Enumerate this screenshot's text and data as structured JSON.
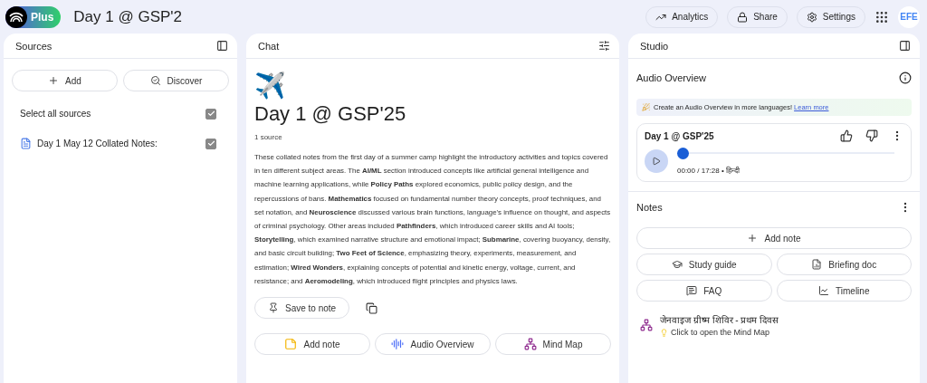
{
  "header": {
    "badge": "Plus",
    "title": "Day 1 @ GSP'2",
    "actions": [
      {
        "kind": "analytics",
        "label": "Analytics"
      },
      {
        "kind": "share",
        "label": "Share"
      },
      {
        "kind": "settings",
        "label": "Settings"
      }
    ],
    "avatar": "EFE"
  },
  "sources": {
    "title": "Sources",
    "buttons": [
      {
        "kind": "add",
        "label": "Add"
      },
      {
        "kind": "discover",
        "label": "Discover"
      }
    ],
    "select_all": {
      "label": "Select all sources",
      "checked": true
    },
    "items": [
      {
        "name": "Day 1 May 12 Collated Notes:",
        "checked": true
      }
    ]
  },
  "chat": {
    "title": "Chat",
    "emoji": "✈️",
    "heading": "Day 1 @ GSP'25",
    "source_count": "1 source",
    "summary": "These collated notes from the first day of a summer camp highlight the introductory activities and topics covered in ten different subject areas. The **AI/ML** section introduced concepts like artificial general intelligence and machine learning applications, while **Policy Paths** explored economics, public policy design, and the repercussions of bans. **Mathematics** focused on fundamental number theory concepts, proof techniques, and set notation, and **Neuroscience** discussed various brain functions, language's influence on thought, and aspects of criminal psychology. Other areas included **Pathfinders**, which introduced career skills and AI tools; **Storytelling**, which examined narrative structure and emotional impact; **Submarine**, covering buoyancy, density, and basic circuit building; **Two Feet of Science**, emphasizing theory, experiments, measurement, and estimation; **Wired Wonders**, explaining concepts of potential and kinetic energy, voltage, current, and resistance; and **Aeromodeling**, which introduced flight principles and physics laws.",
    "save_button": "Save to note",
    "actions": [
      {
        "kind": "note",
        "label": "Add note"
      },
      {
        "kind": "audio",
        "label": "Audio Overview"
      },
      {
        "kind": "mindmap",
        "label": "Mind Map"
      }
    ]
  },
  "studio": {
    "title": "Studio",
    "audio_overview": {
      "title": "Audio Overview",
      "banner": "Create an Audio Overview in more languages!",
      "banner_link": "Learn more",
      "player": {
        "title": "Day 1 @ GSP'25",
        "level": 0,
        "time": "00:00 / 17:28 • हिन्दी"
      }
    },
    "notes": {
      "title": "Notes",
      "add_button": "Add note",
      "tools": [
        {
          "kind": "study",
          "label": "Study guide"
        },
        {
          "kind": "briefing",
          "label": "Briefing doc"
        },
        {
          "kind": "faq",
          "label": "FAQ"
        },
        {
          "kind": "timeline",
          "label": "Timeline"
        }
      ],
      "items": [
        {
          "title": "जेनवाइज ग्रीष्म शिविर - प्रथम दिवस",
          "hint": "Click to open the Mind Map"
        }
      ]
    }
  }
}
